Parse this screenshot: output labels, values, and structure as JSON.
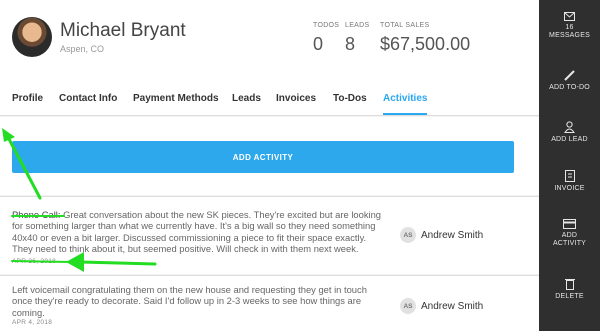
{
  "contact": {
    "name": "Michael Bryant",
    "location": "Aspen, CO"
  },
  "stats": [
    {
      "label": "TODOS",
      "value": "0"
    },
    {
      "label": "LEADS",
      "value": "8"
    },
    {
      "label": "TOTAL SALES",
      "value": "$67,500.00"
    }
  ],
  "tabs": [
    "Profile",
    "Contact Info",
    "Payment Methods",
    "Leads",
    "Invoices",
    "To-Dos",
    "Activities"
  ],
  "active_tab": "Activities",
  "add_activity_label": "ADD ACTIVITY",
  "activities": [
    {
      "type": "Phone Call:",
      "text": " Great conversation about the new SK pieces. They're excited but are looking for something larger than what we currently have. It's a big wall so they need something 40x40 or even a bit larger. Discussed commissioning a piece to fit their space exactly. They need to think about it, but seemed positive. Will check in with them next week.",
      "date": "APR 26, 2018",
      "assignee_initials": "AS",
      "assignee_name": "Andrew Smith"
    },
    {
      "type": "",
      "text": "Left voicemail congratulating them on the new house and requesting they get in touch once they're ready to decorate. Said I'd follow up in 2-3 weeks to see how things are coming.",
      "date": "APR 4, 2018",
      "assignee_initials": "AS",
      "assignee_name": "Andrew Smith"
    }
  ],
  "sidebar": {
    "messages_count": "16",
    "messages_label": "MESSAGES",
    "items": [
      "ADD TO-DO",
      "ADD LEAD",
      "INVOICE",
      "ADD ACTIVITY",
      "DELETE"
    ]
  },
  "annotation_color": "#22dd22",
  "accent_color": "#2ea8ec"
}
